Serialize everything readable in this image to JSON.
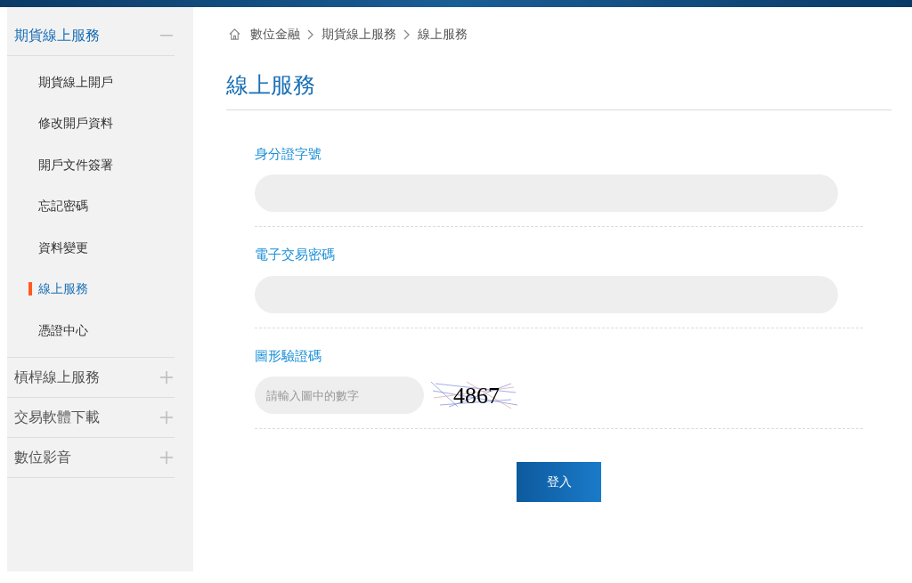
{
  "sidebar": {
    "sections": [
      {
        "label": "期貨線上服務",
        "expanded": true,
        "items": [
          {
            "label": "期貨線上開戶",
            "selected": false
          },
          {
            "label": "修改開戶資料",
            "selected": false
          },
          {
            "label": "開戶文件簽署",
            "selected": false
          },
          {
            "label": "忘記密碼",
            "selected": false
          },
          {
            "label": "資料變更",
            "selected": false
          },
          {
            "label": "線上服務",
            "selected": true
          },
          {
            "label": "憑證中心",
            "selected": false
          }
        ]
      },
      {
        "label": "槓桿線上服務",
        "expanded": false
      },
      {
        "label": "交易軟體下載",
        "expanded": false
      },
      {
        "label": "數位影音",
        "expanded": false
      }
    ]
  },
  "breadcrumb": [
    "數位金融",
    "期貨線上服務",
    "線上服務"
  ],
  "page_title": "線上服務",
  "form": {
    "fields": [
      {
        "kind": "text",
        "label": "身分證字號"
      },
      {
        "kind": "password",
        "label": "電子交易密碼"
      },
      {
        "kind": "captcha",
        "label": "圖形驗證碼",
        "placeholder": "請輸入圖中的數字",
        "captcha": "4867"
      }
    ],
    "submit": "登入"
  }
}
